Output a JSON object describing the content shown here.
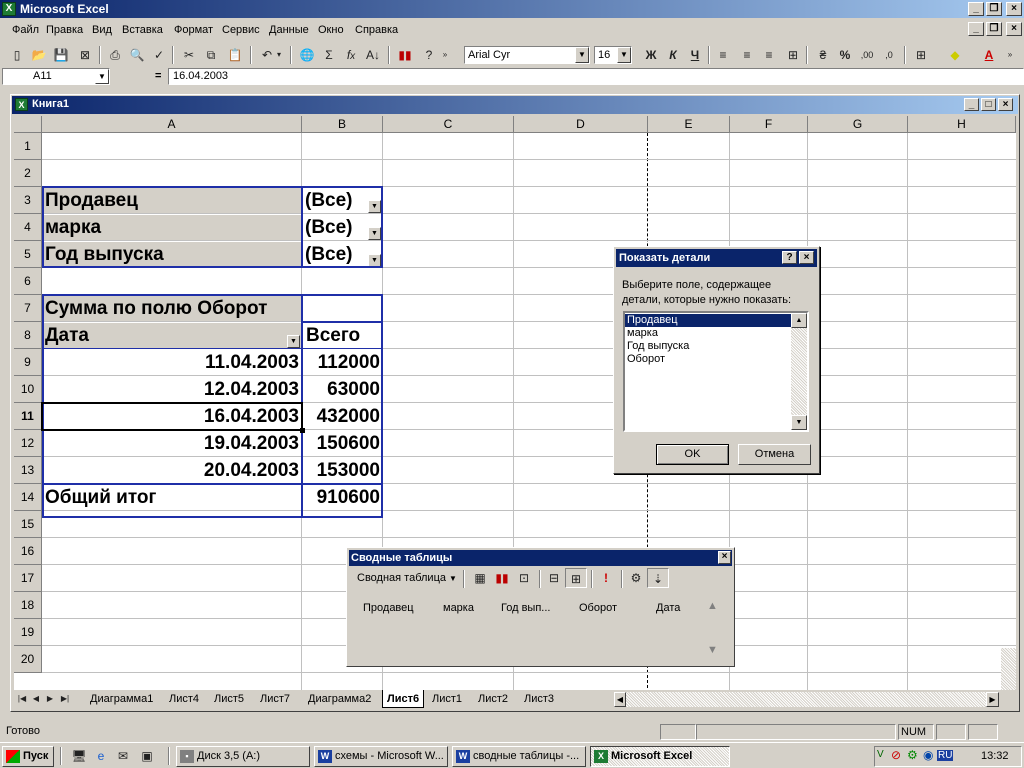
{
  "app": {
    "title": "Microsoft Excel"
  },
  "menu": [
    "Файл",
    "Правка",
    "Вид",
    "Вставка",
    "Формат",
    "Сервис",
    "Данные",
    "Окно",
    "Справка"
  ],
  "toolbar": {
    "font_name": "Arial Cyr",
    "font_size": "16",
    "bold": "Ж",
    "italic": "К",
    "underline": "Ч"
  },
  "formula_bar": {
    "cell_ref": "A11",
    "equals": "=",
    "value": "16.04.2003"
  },
  "workbook": {
    "title": "Книга1"
  },
  "columns": [
    "A",
    "B",
    "C",
    "D",
    "E",
    "F",
    "G",
    "H"
  ],
  "rows": [
    "1",
    "2",
    "3",
    "4",
    "5",
    "6",
    "7",
    "8",
    "9",
    "10",
    "11",
    "12",
    "13",
    "14",
    "15",
    "16",
    "17",
    "18",
    "19",
    "20"
  ],
  "pivot": {
    "page_fields": [
      {
        "label": "Продавец",
        "value": "(Все)"
      },
      {
        "label": "марка",
        "value": "(Все)"
      },
      {
        "label": "Год выпуска",
        "value": "(Все)"
      }
    ],
    "data_caption": "Сумма по полю Оборот",
    "row_field": "Дата",
    "total_col": "Всего",
    "rows": [
      {
        "date": "11.04.2003",
        "value": "112000"
      },
      {
        "date": "12.04.2003",
        "value": "63000"
      },
      {
        "date": "16.04.2003",
        "value": "432000"
      },
      {
        "date": "19.04.2003",
        "value": "150600"
      },
      {
        "date": "20.04.2003",
        "value": "153000"
      }
    ],
    "grand_label": "Общий итог",
    "grand_value": "910600"
  },
  "dialog": {
    "title": "Показать детали",
    "prompt_line1": "Выберите поле, содержащее",
    "prompt_line2": "детали, которые нужно показать:",
    "items": [
      "Продавец",
      "марка",
      "Год выпуска",
      "Оборот"
    ],
    "selected": "Продавец",
    "ok": "OK",
    "cancel": "Отмена"
  },
  "pivot_toolbar": {
    "title": "Сводные таблицы",
    "menu": "Сводная таблица",
    "fields": [
      "Продавец",
      "марка",
      "Год вып...",
      "Оборот",
      "Дата"
    ]
  },
  "sheets": [
    "Диаграмма1",
    "Лист4",
    "Лист5",
    "Лист7",
    "Диаграмма2",
    "Лист6",
    "Лист1",
    "Лист2",
    "Лист3"
  ],
  "active_sheet": "Лист6",
  "status": {
    "text": "Готово",
    "num": "NUM"
  },
  "taskbar": {
    "start": "Пуск",
    "tasks": [
      "Диск 3,5 (A:)",
      "схемы - Microsoft W...",
      "сводные таблицы -...",
      "Microsoft Excel"
    ],
    "lang": "RU",
    "clock": "13:32"
  }
}
